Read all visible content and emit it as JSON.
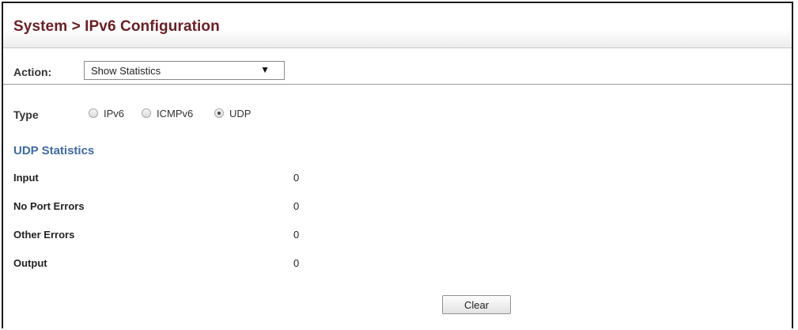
{
  "header": {
    "title": "System > IPv6 Configuration"
  },
  "action": {
    "label": "Action:",
    "selected": "Show Statistics",
    "arrow_glyph": "▼"
  },
  "type": {
    "label": "Type",
    "options": [
      {
        "label": "IPv6",
        "checked": false
      },
      {
        "label": "ICMPv6",
        "checked": false
      },
      {
        "label": "UDP",
        "checked": true
      }
    ]
  },
  "statistics": {
    "heading": "UDP Statistics",
    "rows": [
      {
        "label": "Input",
        "value": "0"
      },
      {
        "label": "No Port Errors",
        "value": "0"
      },
      {
        "label": "Other Errors",
        "value": "0"
      },
      {
        "label": "Output",
        "value": "0"
      }
    ]
  },
  "buttons": {
    "clear_label": "Clear"
  },
  "colors": {
    "title": "#6b1e23",
    "section_heading": "#3f6aa6",
    "frame_border": "#1a1a1a"
  }
}
